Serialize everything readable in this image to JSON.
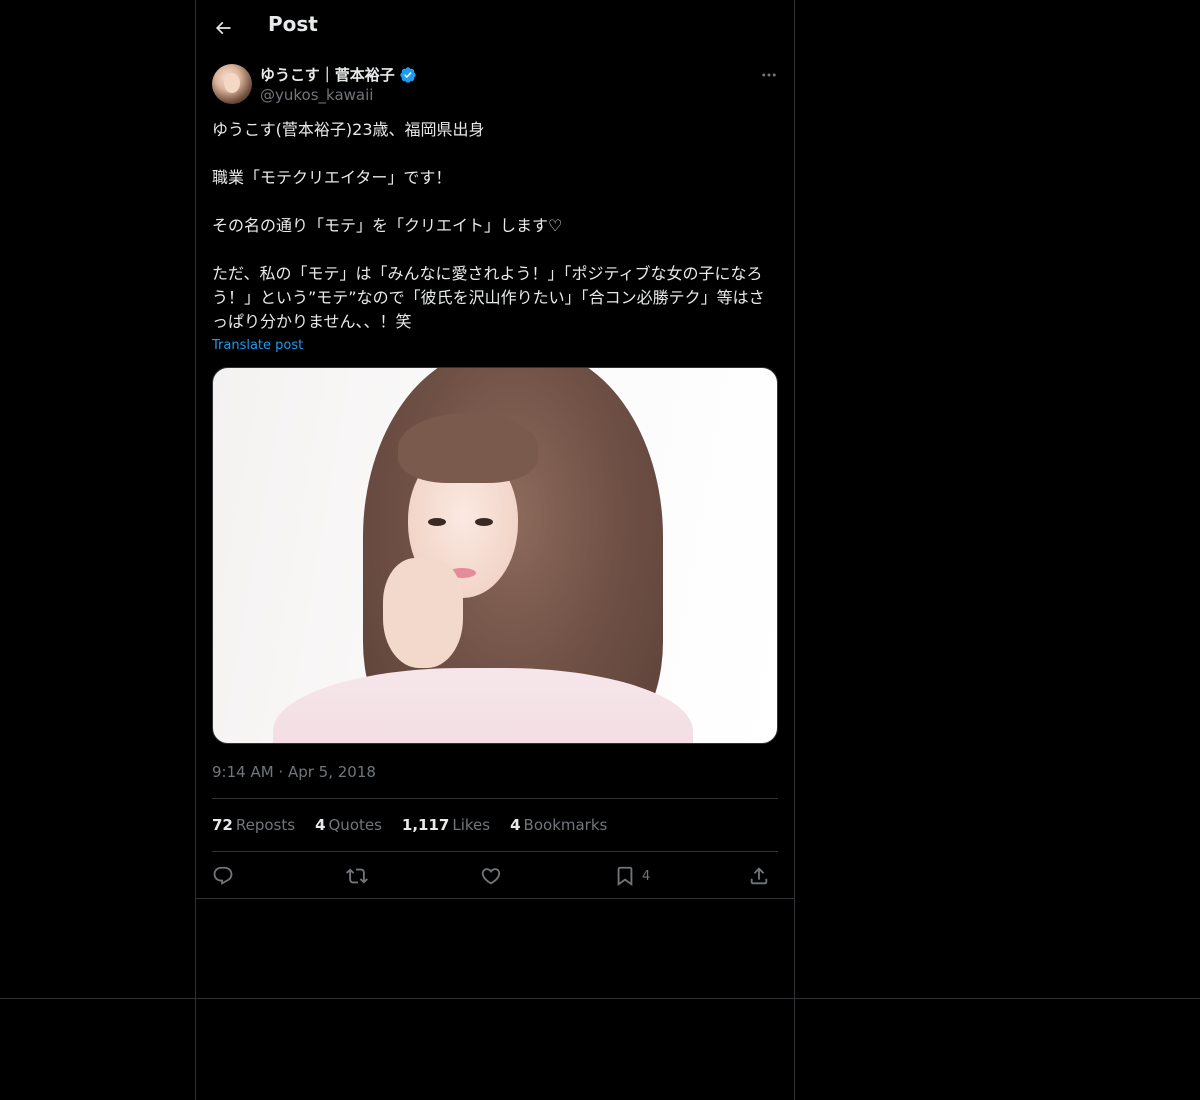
{
  "header": {
    "title": "Post",
    "back_icon": "arrow-left-icon"
  },
  "author": {
    "display_name": "ゆうこす｜菅本裕子",
    "handle": "@yukos_kawaii",
    "verified": true
  },
  "post": {
    "lines": [
      "ゆうこす(菅本裕子)23歳、福岡県出身",
      "",
      "職業「モテクリエイター」です！",
      "",
      "その名の通り「モテ」を「クリエイト」します♡",
      "",
      "ただ、私の「モテ」は「みんなに愛されよう！」「ポジティブな女の子になろう！」という”モテ”なので「彼氏を沢山作りたい」「合コン必勝テク」等はさっぱり分かりません、、！笑"
    ],
    "translate_label": "Translate post",
    "timestamp": "9:14 AM · Apr 5, 2018"
  },
  "stats": {
    "reposts": {
      "count": "72",
      "label": "Reposts"
    },
    "quotes": {
      "count": "4",
      "label": "Quotes"
    },
    "likes": {
      "count": "1,117",
      "label": "Likes"
    },
    "bookmarks": {
      "count": "4",
      "label": "Bookmarks"
    }
  },
  "actions": {
    "reply_icon": "reply-icon",
    "repost_icon": "repost-icon",
    "like_icon": "heart-icon",
    "bookmark_icon": "bookmark-icon",
    "bookmark_count": "4",
    "share_icon": "share-icon"
  },
  "colors": {
    "background": "#000000",
    "text_primary": "#e7e9ea",
    "text_secondary": "#71767b",
    "accent": "#1d9bf0",
    "border": "#2f3336"
  }
}
